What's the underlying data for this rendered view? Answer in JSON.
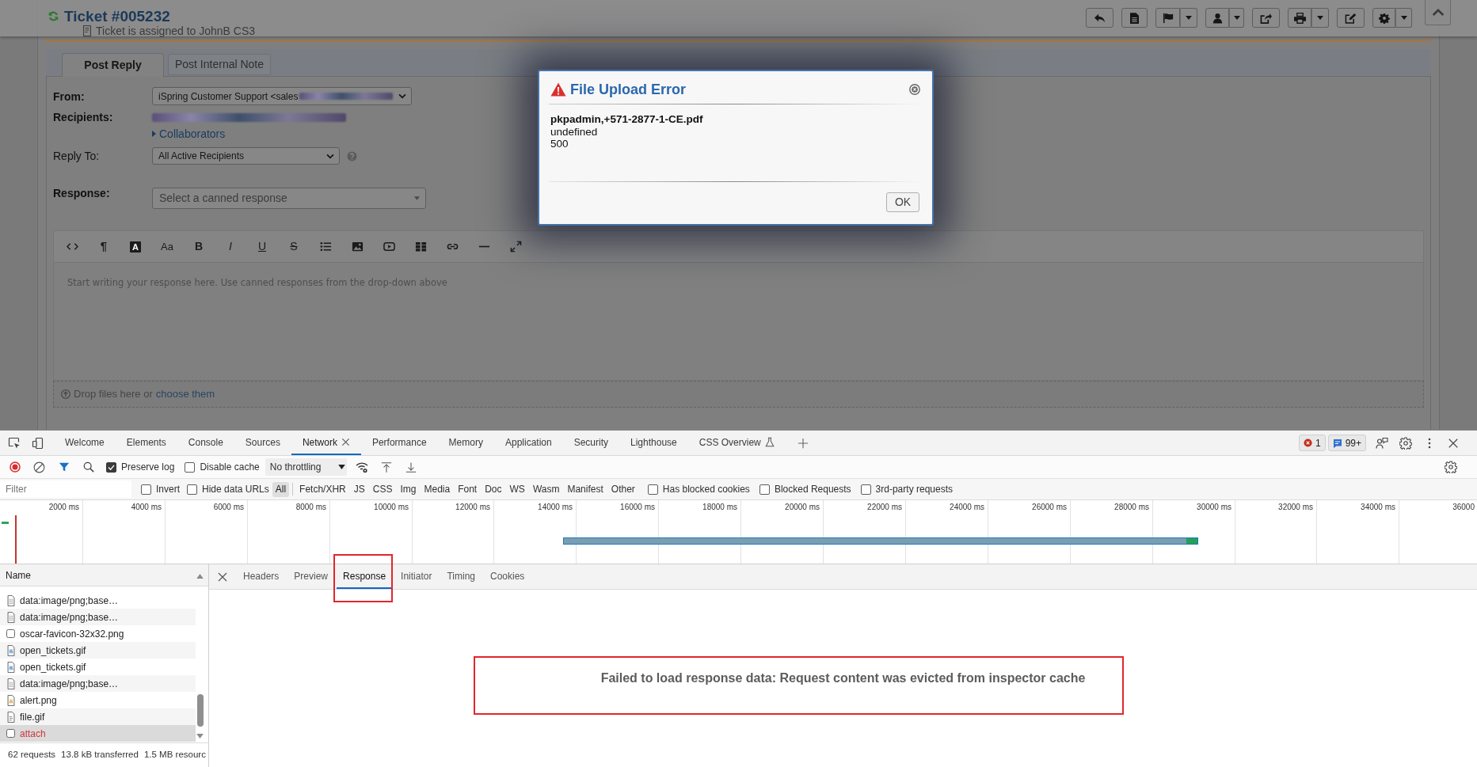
{
  "page": {
    "title": "Ticket #005232",
    "notice": "Ticket is assigned to JohnB CS3",
    "tabs": [
      {
        "label": "Post Reply",
        "selected": true
      },
      {
        "label": "Post Internal Note",
        "selected": false
      }
    ],
    "fields": [
      {
        "kind": "select",
        "label": "From:",
        "required": true,
        "value": "iSpring Customer Support <sales",
        "redacted": true,
        "help": false
      },
      {
        "kind": "recipients",
        "label": "Recipients:",
        "required": true,
        "redacted": true,
        "link": "Collaborators"
      },
      {
        "kind": "select",
        "label": "Reply To:",
        "required": false,
        "value": "All Active Recipients",
        "redacted": false,
        "help": true
      },
      {
        "kind": "combo",
        "label": "Response:",
        "required": true,
        "placeholder": "Select a canned response"
      }
    ],
    "editor": {
      "format_buttons": [
        {
          "kind": "paragraph",
          "glyph": "¶"
        },
        {
          "kind": "color",
          "glyph": "A"
        },
        {
          "kind": "size",
          "glyph": "Aa"
        },
        {
          "kind": "bold",
          "glyph": "B"
        },
        {
          "kind": "italic",
          "glyph": "I"
        },
        {
          "kind": "underline",
          "glyph": "U"
        },
        {
          "kind": "strike",
          "glyph": "S"
        }
      ],
      "placeholder": "Start writing your response here. Use canned responses from the drop-down above",
      "dropzone": {
        "text": "Drop files here or",
        "link": "choose them"
      }
    }
  },
  "dialog": {
    "title": "File Upload Error",
    "filename": "pkpadmin,+571-2877-1-CE.pdf",
    "lines": [
      "undefined",
      "500"
    ],
    "button": "OK"
  },
  "devtools": {
    "tabs": [
      {
        "label": "Welcome",
        "selected": false,
        "closable": false,
        "experimental": false
      },
      {
        "label": "Elements",
        "selected": false,
        "closable": false,
        "experimental": false
      },
      {
        "label": "Console",
        "selected": false,
        "closable": false,
        "experimental": false
      },
      {
        "label": "Sources",
        "selected": false,
        "closable": false,
        "experimental": false
      },
      {
        "label": "Network",
        "selected": true,
        "closable": true,
        "experimental": false
      },
      {
        "label": "Performance",
        "selected": false,
        "closable": false,
        "experimental": false
      },
      {
        "label": "Memory",
        "selected": false,
        "closable": false,
        "experimental": false
      },
      {
        "label": "Application",
        "selected": false,
        "closable": false,
        "experimental": false
      },
      {
        "label": "Security",
        "selected": false,
        "closable": false,
        "experimental": false
      },
      {
        "label": "Lighthouse",
        "selected": false,
        "closable": false,
        "experimental": false
      },
      {
        "label": "CSS Overview",
        "selected": false,
        "closable": false,
        "experimental": true
      }
    ],
    "issues": [
      {
        "kind": "error",
        "count": "1"
      },
      {
        "kind": "message",
        "count": "99+"
      }
    ],
    "network": {
      "recording": true,
      "filter_active": true,
      "options": [
        {
          "label": "Preserve log",
          "checked": true
        },
        {
          "label": "Disable cache",
          "checked": false
        }
      ],
      "throttling": "No throttling",
      "filter": {
        "placeholder": "Filter",
        "options": [
          {
            "label": "Invert",
            "checked": false
          },
          {
            "label": "Hide data URLs",
            "checked": false
          }
        ],
        "types": [
          {
            "label": "All",
            "selected": true
          },
          {
            "label": "Fetch/XHR",
            "selected": false
          },
          {
            "label": "JS",
            "selected": false
          },
          {
            "label": "CSS",
            "selected": false
          },
          {
            "label": "Img",
            "selected": false
          },
          {
            "label": "Media",
            "selected": false
          },
          {
            "label": "Font",
            "selected": false
          },
          {
            "label": "Doc",
            "selected": false
          },
          {
            "label": "WS",
            "selected": false
          },
          {
            "label": "Wasm",
            "selected": false
          },
          {
            "label": "Manifest",
            "selected": false
          },
          {
            "label": "Other",
            "selected": false
          }
        ],
        "blocking": [
          {
            "label": "Has blocked cookies",
            "checked": false
          },
          {
            "label": "Blocked Requests",
            "checked": false
          },
          {
            "label": "3rd-party requests",
            "checked": false
          }
        ]
      },
      "overview": {
        "ticks": [
          "2000 ms",
          "4000 ms",
          "6000 ms",
          "8000 ms",
          "10000 ms",
          "12000 ms",
          "14000 ms",
          "16000 ms",
          "18000 ms",
          "20000 ms",
          "22000 ms",
          "24000 ms",
          "26000 ms",
          "28000 ms",
          "30000 ms",
          "32000 ms",
          "34000 ms",
          "36000"
        ]
      },
      "requests": {
        "column": "Name",
        "rows": [
          {
            "name": "data:image/png;base…",
            "kind": "data",
            "selected": false,
            "failed": false
          },
          {
            "name": "data:image/png;base…",
            "kind": "data",
            "selected": false,
            "failed": false
          },
          {
            "name": "oscar-favicon-32x32.png",
            "kind": "other",
            "selected": false,
            "failed": false
          },
          {
            "name": "open_tickets.gif",
            "kind": "gif",
            "selected": false,
            "failed": false
          },
          {
            "name": "open_tickets.gif",
            "kind": "gif",
            "selected": false,
            "failed": false
          },
          {
            "name": "data:image/png;base…",
            "kind": "data",
            "selected": false,
            "failed": false
          },
          {
            "name": "alert.png",
            "kind": "png",
            "selected": false,
            "failed": false
          },
          {
            "name": "file.gif",
            "kind": "file",
            "selected": false,
            "failed": false
          },
          {
            "name": "attach",
            "kind": "other",
            "selected": true,
            "failed": true
          }
        ],
        "summary": [
          "62 requests",
          "13.8 kB transferred",
          "1.5 MB resourc"
        ]
      },
      "detail": {
        "tabs": [
          {
            "label": "Headers",
            "selected": false
          },
          {
            "label": "Preview",
            "selected": false
          },
          {
            "label": "Response",
            "selected": true
          },
          {
            "label": "Initiator",
            "selected": false
          },
          {
            "label": "Timing",
            "selected": false
          },
          {
            "label": "Cookies",
            "selected": false
          }
        ],
        "message": "Failed to load response data: Request content was evicted from inspector cache"
      }
    }
  }
}
